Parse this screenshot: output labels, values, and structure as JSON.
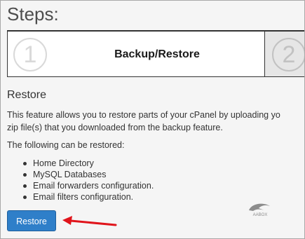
{
  "page": {
    "title": "Steps:"
  },
  "steps": [
    {
      "number": "1",
      "label": "Backup/Restore"
    },
    {
      "number": "2",
      "label": ""
    }
  ],
  "restore": {
    "heading": "Restore",
    "description_lines": [
      "This feature allows you to restore parts of your cPanel by uploading yo",
      "zip file(s) that you downloaded from the backup feature."
    ],
    "restorable_title": "The following can be restored:",
    "items": [
      "Home Directory",
      "MySQL Databases",
      "Email forwarders configuration.",
      "Email filters configuration."
    ],
    "button_label": "Restore"
  },
  "watermark": {
    "text": "AABOX"
  },
  "annotation": {
    "arrow_color": "#e0141b"
  },
  "colors": {
    "button": "#2f7fc9",
    "background": "#f5f5f5"
  }
}
